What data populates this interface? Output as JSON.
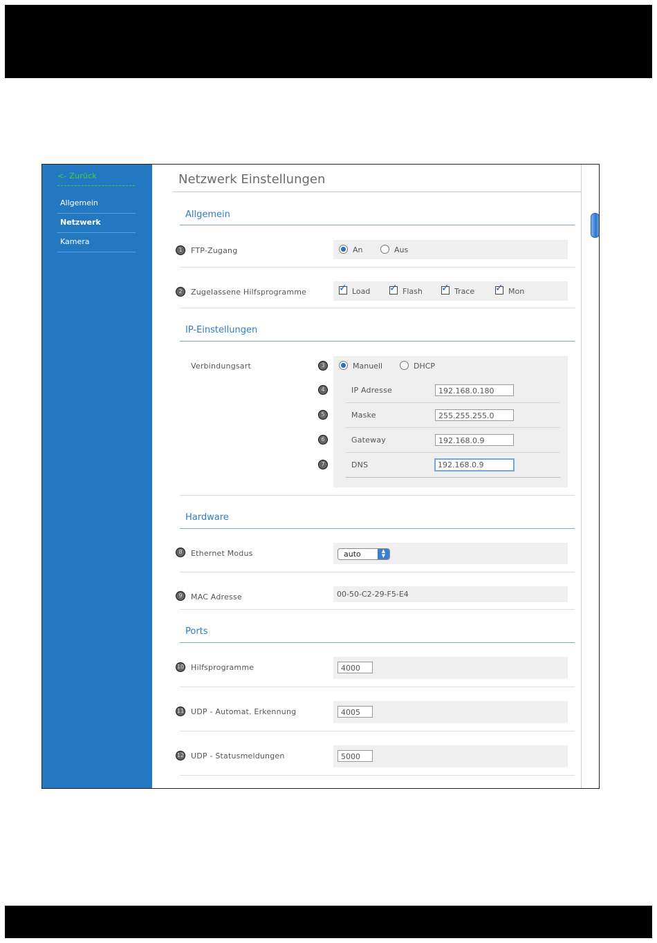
{
  "sidebar": {
    "back": "<- Zurück",
    "items": [
      {
        "label": "Allgemein"
      },
      {
        "label": "Netzwerk"
      },
      {
        "label": "Kamera"
      }
    ]
  },
  "page": {
    "title": "Netzwerk Einstellungen"
  },
  "sections": {
    "allgemein": "Allgemein",
    "ip": "IP-Einstellungen",
    "hardware": "Hardware",
    "ports": "Ports"
  },
  "ftp": {
    "num": "1",
    "label": "FTP-Zugang",
    "on": "An",
    "off": "Aus",
    "selected": "An"
  },
  "tools": {
    "num": "2",
    "label": "Zugelassene Hilfsprogramme",
    "options": [
      "Load",
      "Flash",
      "Trace",
      "Mon"
    ]
  },
  "ip": {
    "label": "Verbindungsart",
    "num": "3",
    "manual": "Manuell",
    "dhcp": "DHCP",
    "selected": "Manuell",
    "fields": [
      {
        "num": "4",
        "label": "IP Adresse",
        "value": "192.168.0.180"
      },
      {
        "num": "5",
        "label": "Maske",
        "value": "255.255.255.0"
      },
      {
        "num": "6",
        "label": "Gateway",
        "value": "192.168.0.9"
      },
      {
        "num": "7",
        "label": "DNS",
        "value": "192.168.0.9"
      }
    ]
  },
  "hardware": {
    "ethernet": {
      "num": "8",
      "label": "Ethernet Modus",
      "value": "auto"
    },
    "mac": {
      "num": "9",
      "label": "MAC Adresse",
      "value": "00-50-C2-29-F5-E4"
    }
  },
  "ports": [
    {
      "num": "10",
      "label": "Hilfsprogramme",
      "value": "4000"
    },
    {
      "num": "11",
      "label": "UDP - Automat. Erkennung",
      "value": "4005"
    },
    {
      "num": "12",
      "label": "UDP - Statusmeldungen",
      "value": "5000"
    }
  ]
}
